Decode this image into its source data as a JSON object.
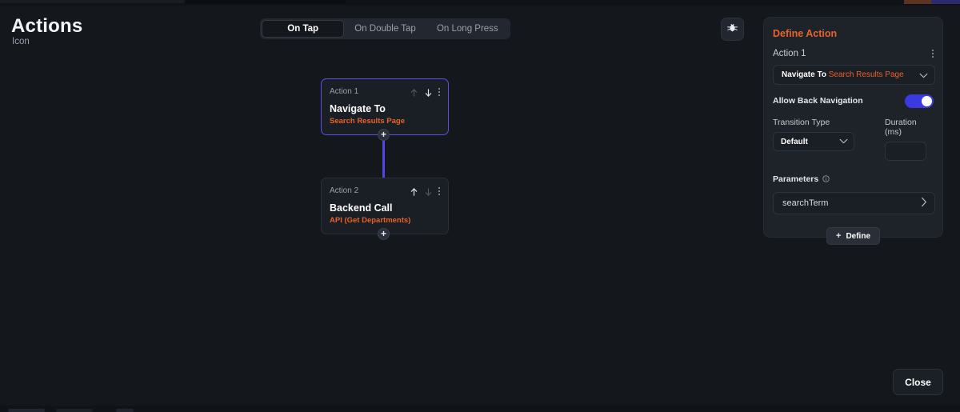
{
  "header": {
    "title": "Actions",
    "subtitle": "Icon"
  },
  "tabs": [
    {
      "label": "On Tap",
      "active": true
    },
    {
      "label": "On Double Tap",
      "active": false
    },
    {
      "label": "On Long Press",
      "active": false
    }
  ],
  "toolbar": {
    "debug_icon": "bug-icon"
  },
  "canvas": {
    "cards": [
      {
        "index_label": "Action 1",
        "title": "Navigate To",
        "subtitle": "Search Results Page",
        "selected": true,
        "move_up_icon": "arrow-up-icon",
        "move_down_icon": "arrow-down-icon",
        "menu_icon": "more-vertical-icon",
        "move_up_enabled": false,
        "move_down_enabled": true
      },
      {
        "index_label": "Action 2",
        "title": "Backend Call",
        "subtitle": "API (Get Departments)",
        "selected": false,
        "move_up_icon": "arrow-up-icon",
        "move_down_icon": "arrow-down-icon",
        "menu_icon": "more-vertical-icon",
        "move_up_enabled": true,
        "move_down_enabled": false
      }
    ],
    "add_button_label": "+",
    "connector_color": "#4f46e5"
  },
  "panel": {
    "title": "Define Action",
    "action_label": "Action 1",
    "menu_icon": "more-vertical-icon",
    "action_select": {
      "prefix": "Navigate To",
      "value": "Search Results Page",
      "chevron_icon": "chevron-down-icon"
    },
    "allow_back_navigation": {
      "label": "Allow Back Navigation",
      "enabled": true
    },
    "transition_type": {
      "label": "Transition Type",
      "value": "Default",
      "chevron_icon": "chevron-down-icon"
    },
    "duration": {
      "label": "Duration (ms)",
      "value": "",
      "placeholder": ""
    },
    "parameters": {
      "label": "Parameters",
      "info_icon": "info-icon",
      "items": [
        {
          "name": "searchTerm",
          "chevron_icon": "chevron-right-icon"
        }
      ]
    },
    "define_button": {
      "label": "Define",
      "plus_icon": "plus-icon"
    }
  },
  "footer": {
    "close_label": "Close"
  },
  "colors": {
    "accent_orange": "#e8622a",
    "accent_indigo": "#4f46e5",
    "toggle_on": "#3b39e0",
    "background": "#14171c",
    "panel_background": "#1e232a",
    "card_background": "#1a1e25"
  }
}
